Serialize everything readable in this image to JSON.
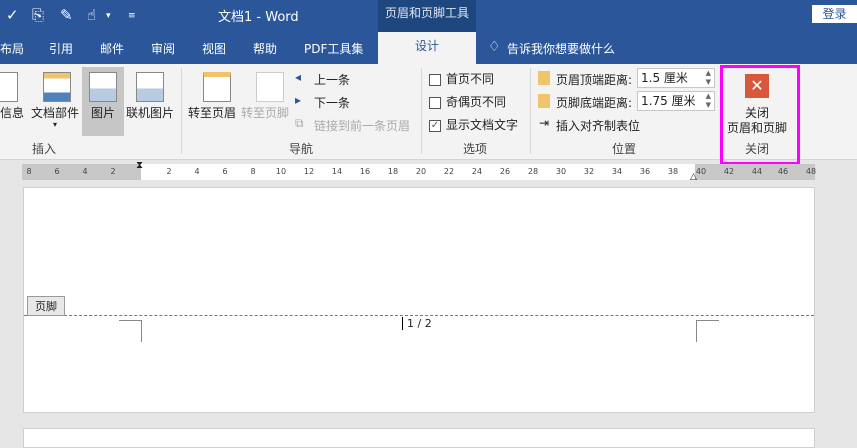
{
  "title": "文档1  -  Word",
  "context_tab": "页眉和页脚工具",
  "login": "登录",
  "tabs": [
    "布局",
    "引用",
    "邮件",
    "审阅",
    "视图",
    "帮助",
    "PDF工具集",
    "设计"
  ],
  "tell_me": "告诉我你想要做什么",
  "insert": {
    "items": [
      "信息",
      "文档部件",
      "图片",
      "联机图片"
    ],
    "label": "插入"
  },
  "nav": {
    "goto_header": "转至页眉",
    "goto_footer": "转至页脚",
    "prev": "上一条",
    "next": "下一条",
    "link": "链接到前一条页眉",
    "label": "导航"
  },
  "options": {
    "first": "首页不同",
    "odd_even": "奇偶页不同",
    "show_text": "显示文档文字",
    "show_text_checked": true,
    "label": "选项"
  },
  "position": {
    "header_dist_label": "页眉顶端距离:",
    "header_dist": "1.5 厘米",
    "footer_dist_label": "页脚底端距离:",
    "footer_dist": "1.75 厘米",
    "insert_tab": "插入对齐制表位",
    "label": "位置"
  },
  "close": {
    "line1": "关闭",
    "line2": "页眉和页脚",
    "label": "关闭"
  },
  "ruler": {
    "left": [
      "8",
      "6",
      "4",
      "2"
    ],
    "right": [
      "2",
      "4",
      "6",
      "8",
      "10",
      "12",
      "14",
      "16",
      "18",
      "20",
      "22",
      "24",
      "26",
      "28",
      "30",
      "32",
      "34",
      "36",
      "38",
      "40",
      "42",
      "44",
      "46",
      "48"
    ]
  },
  "footer_tag": "页脚",
  "page_number": "1 / 2",
  "colors": {
    "brand": "#2b579a",
    "highlight": "#ff00ff",
    "close_icon": "#d9583b"
  }
}
